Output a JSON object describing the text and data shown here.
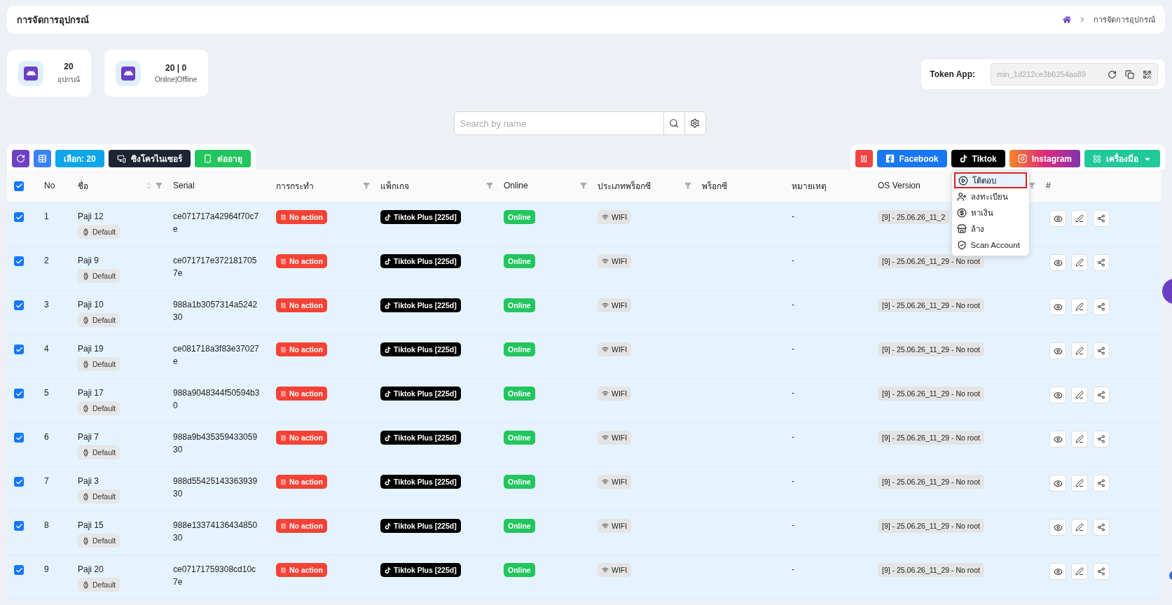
{
  "header": {
    "title": "การจัดการอุปกรณ์",
    "breadcrumb": [
      "การจัดการอุปกรณ์"
    ]
  },
  "stats": [
    {
      "value": "20",
      "label": "อุปกรณ์"
    },
    {
      "value": "20 | 0",
      "label": "Online|Offline"
    }
  ],
  "token": {
    "label": "Token App:",
    "value": "min_1d212ce3b6254aa89"
  },
  "search": {
    "placeholder": "Search by name"
  },
  "left_toolbar": [
    {
      "kind": "refresh"
    },
    {
      "kind": "grid"
    },
    {
      "kind": "select",
      "label": "เลือก: 20"
    },
    {
      "kind": "sync",
      "label": "ซิงโครไนเซอร์"
    },
    {
      "kind": "renew",
      "label": "ต่ออายุ"
    }
  ],
  "right_toolbar": [
    {
      "kind": "pause"
    },
    {
      "kind": "facebook",
      "label": "Facebook"
    },
    {
      "kind": "tiktok",
      "label": "Tiktok",
      "expanded": true,
      "menu": [
        {
          "kind": "play",
          "label": "โต้ตอบ",
          "selected": true
        },
        {
          "kind": "register",
          "label": "ลงทะเบียน",
          "selected": false
        },
        {
          "kind": "earn",
          "label": "หาเงิน",
          "selected": false
        },
        {
          "kind": "clear",
          "label": "ล้าง",
          "selected": false
        },
        {
          "kind": "scan",
          "label": "Scan Account",
          "selected": false
        }
      ]
    },
    {
      "kind": "instagram",
      "label": "Instagram"
    },
    {
      "kind": "tools",
      "label": "เครื่องมือ"
    }
  ],
  "table": {
    "header_checked": true,
    "columns": [
      {
        "label": "No",
        "sort": false,
        "filter": false
      },
      {
        "label": "ชื่อ",
        "sort": true,
        "filter": true
      },
      {
        "label": "Serial",
        "sort": false,
        "filter": false
      },
      {
        "label": "การกระทำ",
        "sort": false,
        "filter": true
      },
      {
        "label": "แพ็กเกจ",
        "sort": false,
        "filter": true
      },
      {
        "label": "Online",
        "sort": false,
        "filter": true
      },
      {
        "label": "ประเภทพร็อกซี",
        "sort": false,
        "filter": true
      },
      {
        "label": "พร็อกซี",
        "sort": false,
        "filter": false
      },
      {
        "label": "หมายเหตุ",
        "sort": false,
        "filter": false
      },
      {
        "label": "OS Version",
        "sort": false,
        "filter": true
      },
      {
        "label": "#",
        "sort": false,
        "filter": false
      }
    ],
    "rows": [
      {
        "selected": true,
        "no": "1",
        "name": "Paji 12",
        "tag": "Default",
        "serial": "ce071717a42964f70c7e",
        "action": "No action",
        "package": "Tiktok Plus [225d]",
        "status": "Online",
        "proxy_type": "WIFI",
        "note": "-",
        "os": "[9] - 25.06.26_11_2"
      },
      {
        "selected": true,
        "no": "2",
        "name": "Paji 9",
        "tag": "Default",
        "serial": "ce071717e3721817057e",
        "action": "No action",
        "package": "Tiktok Plus [225d]",
        "status": "Online",
        "proxy_type": "WIFI",
        "note": "-",
        "os": "[9] - 25.06.26_11_29 - No root"
      },
      {
        "selected": true,
        "no": "3",
        "name": "Paji 10",
        "tag": "Default",
        "serial": "988a1b3057314a524230",
        "action": "No action",
        "package": "Tiktok Plus [225d]",
        "status": "Online",
        "proxy_type": "WIFI",
        "note": "-",
        "os": "[9] - 25.06.26_11_29 - No root"
      },
      {
        "selected": true,
        "no": "4",
        "name": "Paji 19",
        "tag": "Default",
        "serial": "ce081718a3f83e37027e",
        "action": "No action",
        "package": "Tiktok Plus [225d]",
        "status": "Online",
        "proxy_type": "WIFI",
        "note": "-",
        "os": "[9] - 25.06.26_11_29 - No root"
      },
      {
        "selected": true,
        "no": "5",
        "name": "Paji 17",
        "tag": "Default",
        "serial": "988a9048344f50594b30",
        "action": "No action",
        "package": "Tiktok Plus [225d]",
        "status": "Online",
        "proxy_type": "WIFI",
        "note": "-",
        "os": "[9] - 25.06.26_11_29 - No root"
      },
      {
        "selected": true,
        "no": "6",
        "name": "Paji 7",
        "tag": "Default",
        "serial": "988a9b43535943305930",
        "action": "No action",
        "package": "Tiktok Plus [225d]",
        "status": "Online",
        "proxy_type": "WIFI",
        "note": "-",
        "os": "[9] - 25.06.26_11_29 - No root"
      },
      {
        "selected": true,
        "no": "7",
        "name": "Paji 3",
        "tag": "Default",
        "serial": "988d5542514336393930",
        "action": "No action",
        "package": "Tiktok Plus [225d]",
        "status": "Online",
        "proxy_type": "WIFI",
        "note": "-",
        "os": "[9] - 25.06.26_11_29 - No root"
      },
      {
        "selected": true,
        "no": "8",
        "name": "Paji 15",
        "tag": "Default",
        "serial": "988e1337413643485030",
        "action": "No action",
        "package": "Tiktok Plus [225d]",
        "status": "Online",
        "proxy_type": "WIFI",
        "note": "-",
        "os": "[9] - 25.06.26_11_29 - No root"
      },
      {
        "selected": true,
        "no": "9",
        "name": "Paji 20",
        "tag": "Default",
        "serial": "ce07171759308cd10c7e",
        "action": "No action",
        "package": "Tiktok Plus [225d]",
        "status": "Online",
        "proxy_type": "WIFI",
        "note": "-",
        "os": "[9] - 25.06.26_11_29 - No root"
      }
    ]
  }
}
